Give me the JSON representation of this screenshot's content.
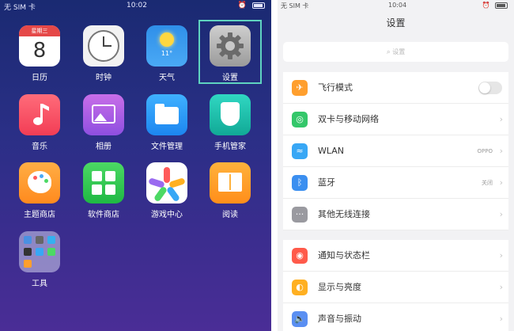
{
  "home": {
    "status": {
      "carrier": "无 SIM 卡",
      "time": "10:02"
    },
    "calendar_weekday": "星期三",
    "calendar_date": "8",
    "weather_temp": "11°",
    "apps": [
      {
        "label": "日历"
      },
      {
        "label": "时钟"
      },
      {
        "label": "天气"
      },
      {
        "label": "设置"
      },
      {
        "label": "音乐"
      },
      {
        "label": "相册"
      },
      {
        "label": "文件管理"
      },
      {
        "label": "手机管家"
      },
      {
        "label": "主题商店"
      },
      {
        "label": "软件商店"
      },
      {
        "label": "游戏中心"
      },
      {
        "label": "阅读"
      },
      {
        "label": "工具"
      }
    ]
  },
  "settings": {
    "status": {
      "carrier": "无 SIM 卡",
      "time": "10:04"
    },
    "title": "设置",
    "search_placeholder": "设置",
    "items": [
      {
        "label": "飞行模式",
        "value": "",
        "toggle_on": false
      },
      {
        "label": "双卡与移动网络",
        "value": ""
      },
      {
        "label": "WLAN",
        "value": "OPPO"
      },
      {
        "label": "蓝牙",
        "value": "关闭"
      },
      {
        "label": "其他无线连接",
        "value": ""
      },
      {
        "label": "通知与状态栏",
        "value": ""
      },
      {
        "label": "显示与亮度",
        "value": ""
      },
      {
        "label": "声音与振动",
        "value": ""
      }
    ]
  },
  "colors": {
    "highlight": "#5fd3c0",
    "airplane": "#ff9f2e",
    "sim": "#34c76a",
    "wlan": "#38a7f5",
    "bluetooth": "#3b8ff0",
    "other_wireless": "#9a9aa0",
    "notification": "#ff5a4a",
    "display": "#ffb022",
    "sound": "#5a8ff2"
  }
}
